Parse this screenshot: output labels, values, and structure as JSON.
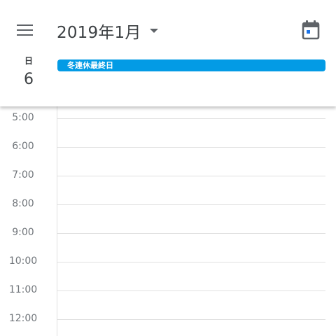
{
  "header": {
    "menu_icon": "hamburger-menu-icon",
    "title": "2019年1月",
    "dropdown_icon": "caret-down-icon",
    "today_icon": "calendar-today-icon"
  },
  "day": {
    "weekday": "日",
    "date": "6"
  },
  "all_day_events": [
    {
      "title": "冬連休最終日",
      "color": "#039be5"
    }
  ],
  "time_grid": {
    "hours": [
      "5:00",
      "6:00",
      "7:00",
      "8:00",
      "9:00",
      "10:00",
      "11:00",
      "12:00"
    ]
  },
  "colors": {
    "event_blue": "#039be5",
    "grid_line": "#e0e0e0",
    "hour_text": "#70757a"
  }
}
